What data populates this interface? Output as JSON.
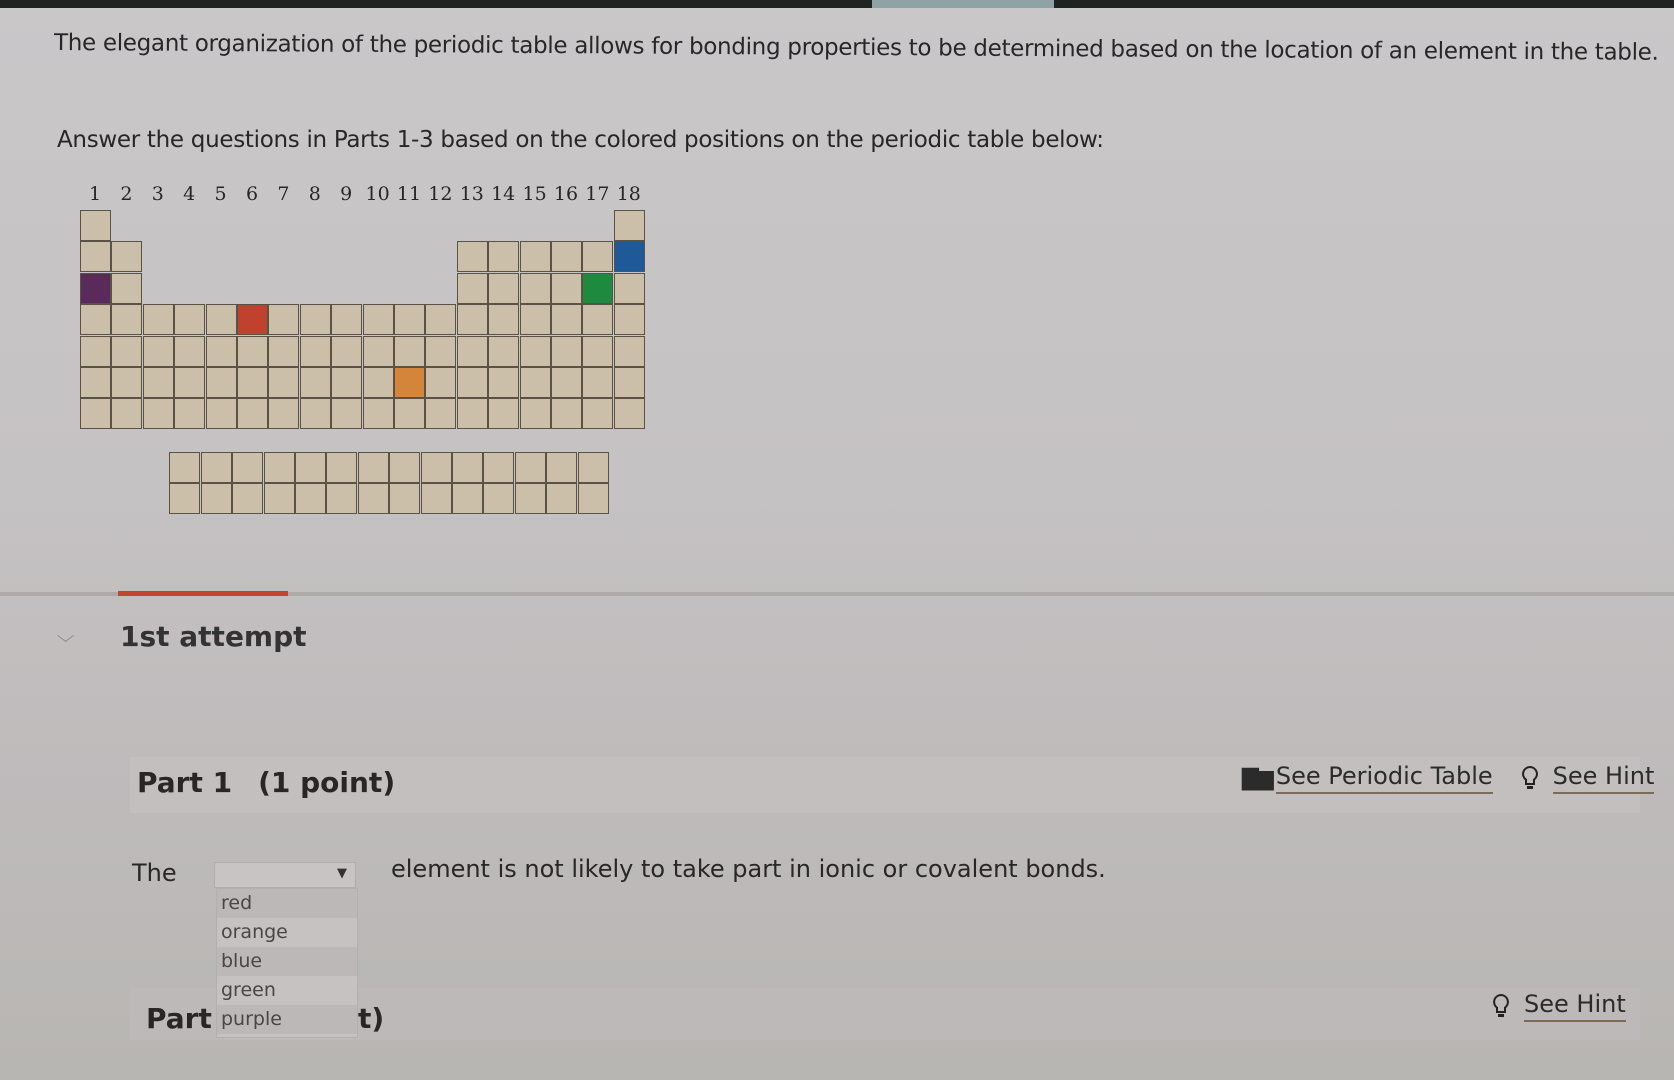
{
  "intro_text": "The elegant organization of the periodic table allows for bonding properties to be determined based on the location of an element in the table.",
  "instructions": "Answer the questions in Parts 1-3 based on the colored positions on the periodic table below:",
  "periodic_table": {
    "group_labels": [
      "1",
      "2",
      "3",
      "4",
      "5",
      "6",
      "7",
      "8",
      "9",
      "10",
      "11",
      "12",
      "13",
      "14",
      "15",
      "16",
      "17",
      "18"
    ],
    "cell_color": "#cbbfa9",
    "highlighted": [
      {
        "name": "purple",
        "period": 3,
        "group": 1,
        "color": "#5a2a5a"
      },
      {
        "name": "red",
        "period": 4,
        "group": 6,
        "color": "#c0412d"
      },
      {
        "name": "orange",
        "period": 6,
        "group": 11,
        "color": "#d4853a"
      },
      {
        "name": "green",
        "period": 3,
        "group": 17,
        "color": "#1e8a40"
      },
      {
        "name": "blue",
        "period": 2,
        "group": 18,
        "color": "#1e5a9a"
      }
    ],
    "f_block_rows": 2,
    "f_block_cols": 14
  },
  "attempt": {
    "label": "1st attempt"
  },
  "part1": {
    "title": "Part 1",
    "points": "(1 point)",
    "see_periodic_table": "See Periodic Table",
    "see_hint": "See Hint",
    "question_prefix": "The",
    "question_suffix": "element is not likely to take part in ionic or covalent bonds.",
    "select_value": "",
    "options": [
      "red",
      "orange",
      "blue",
      "green",
      "purple"
    ]
  },
  "part2": {
    "title": "Part :",
    "tail": "t)",
    "see_hint": "See Hint"
  }
}
